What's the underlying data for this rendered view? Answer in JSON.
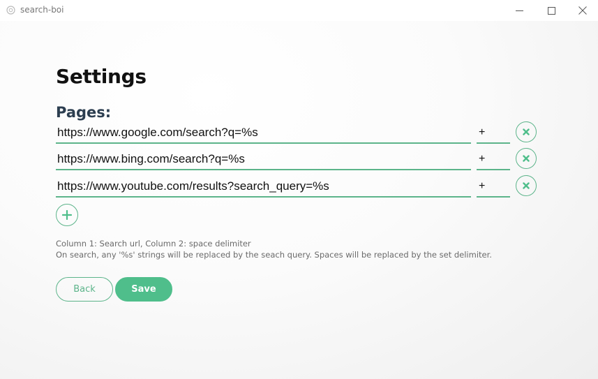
{
  "window": {
    "title": "search-boi"
  },
  "page": {
    "heading": "Settings",
    "pages_label": "Pages:"
  },
  "pages": [
    {
      "url": "https://www.google.com/search?q=%s",
      "delimiter": "+"
    },
    {
      "url": "https://www.bing.com/search?q=%s",
      "delimiter": "+"
    },
    {
      "url": "https://www.youtube.com/results?search_query=%s",
      "delimiter": "+"
    }
  ],
  "help": {
    "line1": "Column 1: Search url, Column 2: space delimiter",
    "line2": "On search, any '%s' strings will be replaced by the seach query. Spaces will be replaced by the set delimiter."
  },
  "buttons": {
    "back": "Back",
    "save": "Save"
  },
  "icons": {
    "app": "app-logo-icon",
    "minimize": "minimize-icon",
    "maximize": "maximize-icon",
    "close": "close-icon",
    "remove": "remove-icon",
    "add": "plus-icon"
  },
  "colors": {
    "accent": "#4fbe8b",
    "underline": "#5cb48a",
    "heading": "#111111",
    "subheading": "#2c3e50",
    "help_text": "#6a6a6a"
  }
}
